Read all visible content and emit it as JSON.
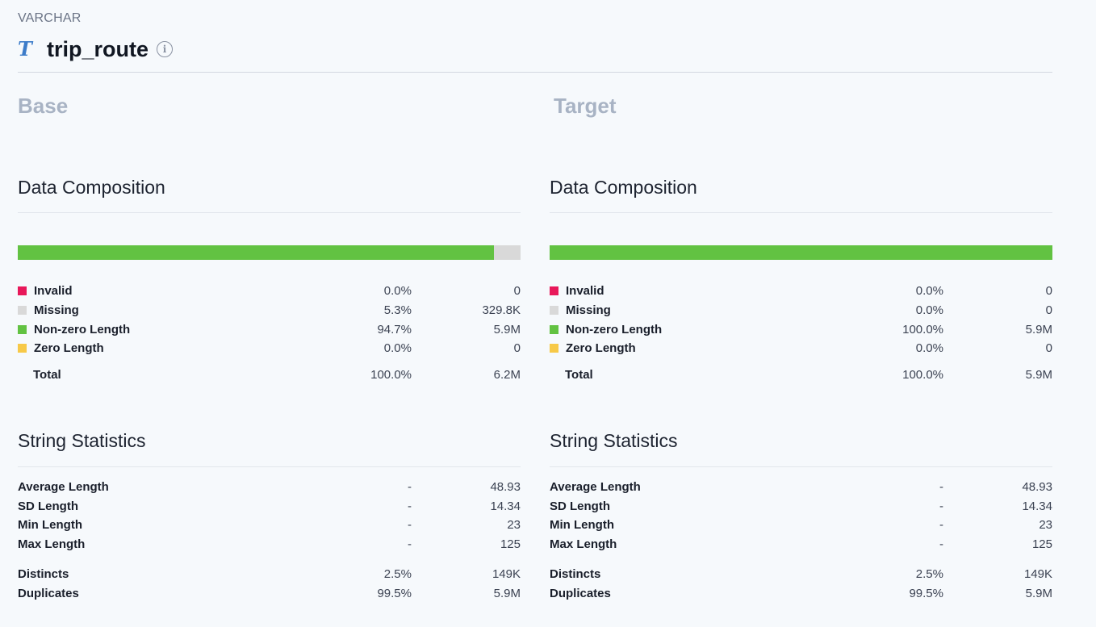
{
  "header": {
    "type_label": "VARCHAR",
    "type_icon": "T",
    "column_name": "trip_route",
    "info_icon": "i"
  },
  "colors": {
    "invalid": "#e8185a",
    "missing": "#d9d9d9",
    "non_zero_length": "#62c242",
    "zero_length": "#f7c948",
    "heading_muted": "#a8b3c4"
  },
  "panels": [
    {
      "title": "Base",
      "composition": {
        "title": "Data Composition",
        "bar_fractions": {
          "invalid": 0.0,
          "missing": 0.053,
          "non_zero_length": 0.947,
          "zero_length": 0.0
        },
        "rows": [
          {
            "key": "invalid",
            "label": "Invalid",
            "pct": "0.0%",
            "value": "0"
          },
          {
            "key": "missing",
            "label": "Missing",
            "pct": "5.3%",
            "value": "329.8K"
          },
          {
            "key": "non_zero_length",
            "label": "Non-zero Length",
            "pct": "94.7%",
            "value": "5.9M"
          },
          {
            "key": "zero_length",
            "label": "Zero Length",
            "pct": "0.0%",
            "value": "0"
          }
        ],
        "total": {
          "label": "Total",
          "pct": "100.0%",
          "value": "6.2M"
        }
      },
      "string_stats": {
        "title": "String Statistics",
        "rows": [
          {
            "label": "Average Length",
            "pct": "-",
            "value": "48.93"
          },
          {
            "label": "SD Length",
            "pct": "-",
            "value": "14.34"
          },
          {
            "label": "Min Length",
            "pct": "-",
            "value": "23"
          },
          {
            "label": "Max Length",
            "pct": "-",
            "value": "125"
          }
        ],
        "rows2": [
          {
            "label": "Distincts",
            "pct": "2.5%",
            "value": "149K"
          },
          {
            "label": "Duplicates",
            "pct": "99.5%",
            "value": "5.9M"
          }
        ]
      }
    },
    {
      "title": "Target",
      "composition": {
        "title": "Data Composition",
        "bar_fractions": {
          "invalid": 0.0,
          "missing": 0.0,
          "non_zero_length": 1.0,
          "zero_length": 0.0
        },
        "rows": [
          {
            "key": "invalid",
            "label": "Invalid",
            "pct": "0.0%",
            "value": "0"
          },
          {
            "key": "missing",
            "label": "Missing",
            "pct": "0.0%",
            "value": "0"
          },
          {
            "key": "non_zero_length",
            "label": "Non-zero Length",
            "pct": "100.0%",
            "value": "5.9M"
          },
          {
            "key": "zero_length",
            "label": "Zero Length",
            "pct": "0.0%",
            "value": "0"
          }
        ],
        "total": {
          "label": "Total",
          "pct": "100.0%",
          "value": "5.9M"
        }
      },
      "string_stats": {
        "title": "String Statistics",
        "rows": [
          {
            "label": "Average Length",
            "pct": "-",
            "value": "48.93"
          },
          {
            "label": "SD Length",
            "pct": "-",
            "value": "14.34"
          },
          {
            "label": "Min Length",
            "pct": "-",
            "value": "23"
          },
          {
            "label": "Max Length",
            "pct": "-",
            "value": "125"
          }
        ],
        "rows2": [
          {
            "label": "Distincts",
            "pct": "2.5%",
            "value": "149K"
          },
          {
            "label": "Duplicates",
            "pct": "99.5%",
            "value": "5.9M"
          }
        ]
      }
    }
  ]
}
